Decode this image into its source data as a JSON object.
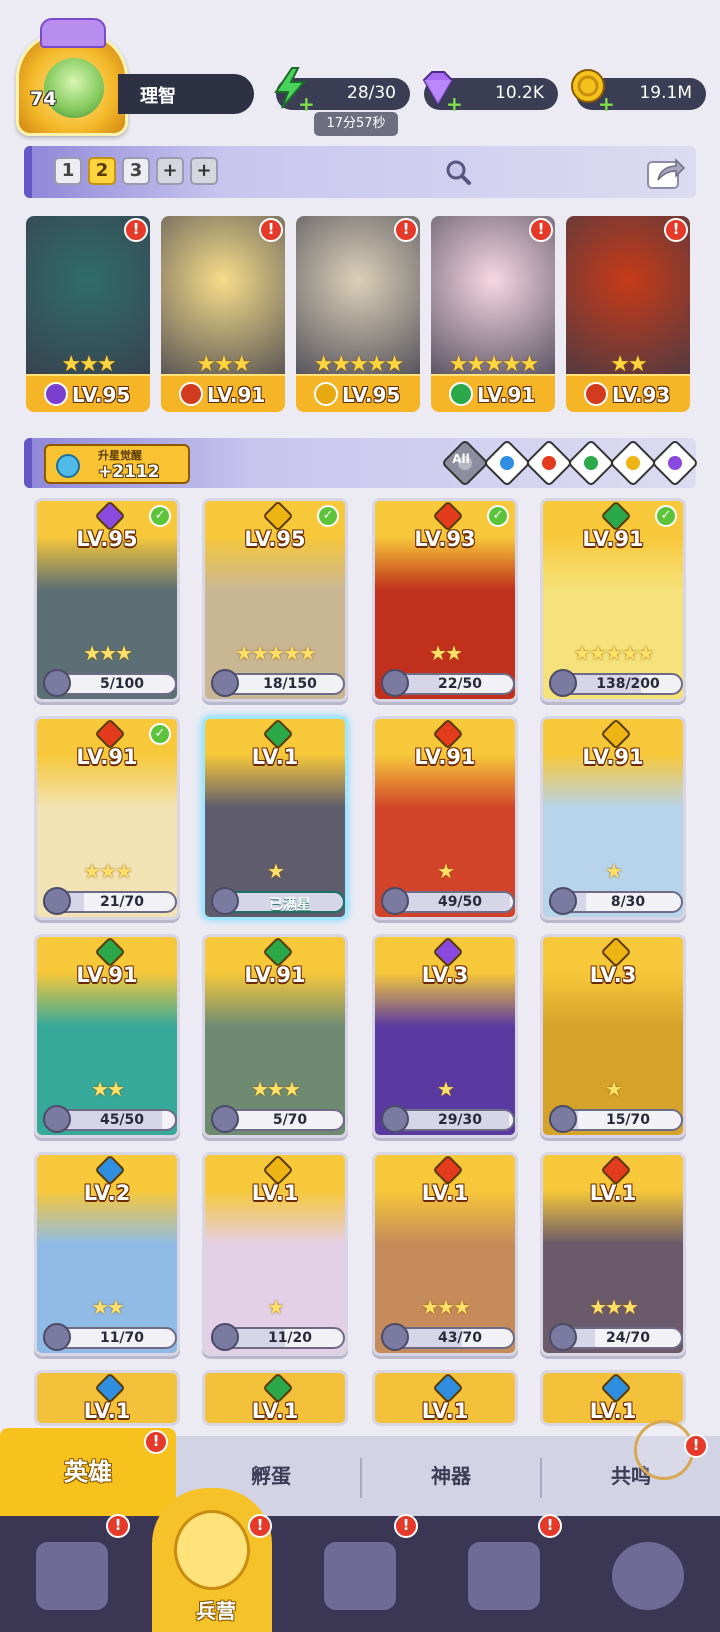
{
  "header": {
    "player_level": "74",
    "player_name": "理智",
    "energy": {
      "value": "28/30",
      "timer": "17分57秒",
      "color": "#49d35a"
    },
    "gems": {
      "value": "10.2K",
      "color": "#a86bf2"
    },
    "gold": {
      "value": "19.1M",
      "color": "#f4c21d"
    }
  },
  "team_bar": {
    "slots": [
      "1",
      "2",
      "3",
      "+",
      "+"
    ],
    "active_slot": "2"
  },
  "featured": [
    {
      "level": "LV.95",
      "stars": "★★★",
      "element": "dark",
      "element_color": "#7b3fd0",
      "art": "#2f6d6a",
      "alert": "!"
    },
    {
      "level": "LV.91",
      "stars": "★★★",
      "element": "fire",
      "element_color": "#d33b1e",
      "art": "#f6dd8a",
      "alert": "!"
    },
    {
      "level": "LV.95",
      "stars": "★★★★★",
      "element": "light",
      "element_color": "#e6a90f",
      "art": "#dcd0b8",
      "alert": "!"
    },
    {
      "level": "LV.91",
      "stars": "★★★★★",
      "element": "wind",
      "element_color": "#2ba84a",
      "art": "#f8d7e2",
      "alert": "!"
    },
    {
      "level": "LV.93",
      "stars": "★★",
      "element": "fire",
      "element_color": "#d33b1e",
      "art": "#c73a18",
      "alert": "!"
    }
  ],
  "awaken": {
    "title": "升星觉醒",
    "value": "+2112",
    "filters": [
      {
        "name": "all",
        "label": "All",
        "color": "#b7b6c2"
      },
      {
        "name": "water",
        "label": "",
        "color": "#2f8ee0"
      },
      {
        "name": "fire",
        "label": "",
        "color": "#e23b1e"
      },
      {
        "name": "wind",
        "label": "",
        "color": "#2ba84a"
      },
      {
        "name": "light",
        "label": "",
        "color": "#eeb414"
      },
      {
        "name": "dark",
        "label": "",
        "color": "#8a4ae0"
      }
    ]
  },
  "heroes": [
    {
      "level": "LV.95",
      "stars": "★★★",
      "fragments": "5/100",
      "progress": 0.05,
      "element_color": "#8a4ae0",
      "art": "#5b6f74",
      "check": true,
      "maxed": false
    },
    {
      "level": "LV.95",
      "stars": "★★★★★",
      "fragments": "18/150",
      "progress": 0.12,
      "element_color": "#eeb414",
      "art": "#c9b794",
      "check": true,
      "maxed": false
    },
    {
      "level": "LV.93",
      "stars": "★★",
      "fragments": "22/50",
      "progress": 0.44,
      "element_color": "#e23b1e",
      "art": "#c0301c",
      "check": true,
      "maxed": false
    },
    {
      "level": "LV.91",
      "stars": "★★★★★",
      "fragments": "138/200",
      "progress": 0.69,
      "element_color": "#2ba84a",
      "art": "#f5e27a",
      "check": true,
      "maxed": false
    },
    {
      "level": "LV.91",
      "stars": "★★★",
      "fragments": "21/70",
      "progress": 0.3,
      "element_color": "#e23b1e",
      "art": "#f2e3b4",
      "check": true,
      "maxed": false
    },
    {
      "level": "LV.1",
      "stars": "★",
      "fragments": "已满星",
      "progress": 1.0,
      "element_color": "#2ba84a",
      "art": "#5f5c6e",
      "check": false,
      "maxed": true
    },
    {
      "level": "LV.91",
      "stars": "★",
      "fragments": "49/50",
      "progress": 0.98,
      "element_color": "#e23b1e",
      "art": "#d2442a",
      "check": false,
      "maxed": false
    },
    {
      "level": "LV.91",
      "stars": "★",
      "fragments": "8/30",
      "progress": 0.27,
      "element_color": "#eeb414",
      "art": "#b8d4ea",
      "check": false,
      "maxed": false
    },
    {
      "level": "LV.91",
      "stars": "★★",
      "fragments": "45/50",
      "progress": 0.9,
      "element_color": "#2ba84a",
      "art": "#36a99a",
      "check": false,
      "maxed": false
    },
    {
      "level": "LV.91",
      "stars": "★★★",
      "fragments": "5/70",
      "progress": 0.07,
      "element_color": "#2ba84a",
      "art": "#6e8b72",
      "check": false,
      "maxed": false
    },
    {
      "level": "LV.3",
      "stars": "★",
      "fragments": "29/30",
      "progress": 0.97,
      "element_color": "#8a4ae0",
      "art": "#5a3aa0",
      "check": false,
      "maxed": false
    },
    {
      "level": "LV.3",
      "stars": "★",
      "fragments": "15/70",
      "progress": 0.21,
      "element_color": "#eeb414",
      "art": "#d6a32a",
      "check": false,
      "maxed": false
    },
    {
      "level": "LV.2",
      "stars": "★★",
      "fragments": "11/70",
      "progress": 0.16,
      "element_color": "#2f8ee0",
      "art": "#8fbbe6",
      "check": false,
      "maxed": false
    },
    {
      "level": "LV.1",
      "stars": "★",
      "fragments": "11/20",
      "progress": 0.55,
      "element_color": "#eeb414",
      "art": "#e3cfe6",
      "check": false,
      "maxed": false
    },
    {
      "level": "LV.1",
      "stars": "★★★",
      "fragments": "43/70",
      "progress": 0.61,
      "element_color": "#e23b1e",
      "art": "#c68b5a",
      "check": false,
      "maxed": false
    },
    {
      "level": "LV.1",
      "stars": "★★★",
      "fragments": "24/70",
      "progress": 0.34,
      "element_color": "#e23b1e",
      "art": "#6a5a6a",
      "check": false,
      "maxed": false
    }
  ],
  "partial_row": [
    {
      "level": "LV.1",
      "element_color": "#2f8ee0"
    },
    {
      "level": "LV.1",
      "element_color": "#2ba84a"
    },
    {
      "level": "LV.1",
      "element_color": "#2f8ee0"
    },
    {
      "level": "LV.1",
      "element_color": "#2f8ee0"
    }
  ],
  "sub_tabs": [
    {
      "label": "英雄",
      "active": true,
      "alert": "!"
    },
    {
      "label": "孵蛋",
      "active": false
    },
    {
      "label": "神器",
      "active": false
    },
    {
      "label": "共鸣",
      "active": false,
      "alert": "!"
    }
  ],
  "bottom_nav": [
    {
      "name": "cards",
      "label": "",
      "alert": "!",
      "active": false
    },
    {
      "name": "barracks",
      "label": "兵营",
      "alert": "!",
      "active": true
    },
    {
      "name": "book",
      "label": "",
      "alert": "!",
      "active": false
    },
    {
      "name": "castle",
      "label": "",
      "alert": "!",
      "active": false
    },
    {
      "name": "mushroom",
      "label": "",
      "alert": "",
      "active": false
    }
  ]
}
